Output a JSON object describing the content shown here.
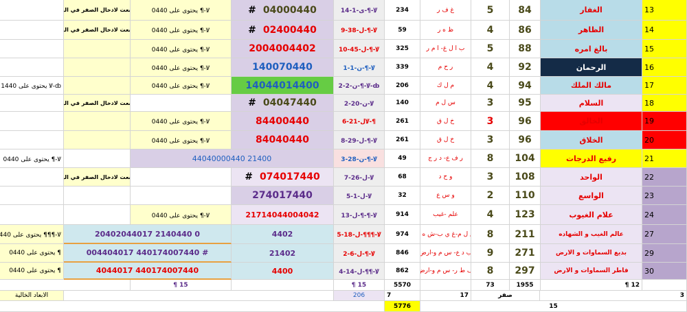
{
  "rows": [
    {
      "num": "13",
      "name": "الغفار",
      "c1": "84",
      "c2": "5",
      "letters": "غ ف ر",
      "c4": "234",
      "code": "ى-1-14-¶-Ꝟ",
      "big": "04000440",
      "hash": "#",
      "contains": "يحتوى على 0440 ¶-Ꝟ",
      "note": "وضعت لادخال الصفر في اليسار#"
    },
    {
      "num": "14",
      "name": "الظاهر",
      "c1": "86",
      "c2": "4",
      "letters": "ظ ه ر",
      "c4": "59",
      "code": "ل-38-9-¶-Ꝟ",
      "big": "02400440",
      "hash": "#",
      "contains": "يحتوى على 0440 ¶-Ꝟ",
      "note": "وضعت لادخال الصفر في اليسار#"
    },
    {
      "num": "15",
      "name": "بالغ امره",
      "c1": "88",
      "c2": "5",
      "letters": "ب ا ل غ- ا م ر",
      "c4": "325",
      "code": "ل-45-10-¶-Ꝟ",
      "big": "2004004402",
      "contains": "يحتوى على 0440 ¶-Ꝟ"
    },
    {
      "num": "16",
      "name": "الرحمان",
      "c1": "92",
      "c2": "4",
      "letters": "ر ح م",
      "c4": "339",
      "code": "ن-1-1-¶-Ꝟ",
      "big": "140070440",
      "contains": "يحتوى على 0440 ¶-Ꝟ"
    },
    {
      "num": "17",
      "name": "مالك الملك",
      "c1": "94",
      "c2": "4",
      "letters": "م ل ك",
      "c4": "206",
      "code": "ن-2-2-¶-Ꝟ-ȸ",
      "big": "14044014400",
      "contains": "يحتوى على 0440 ¶-Ꝟ",
      "extra": "يحتوى على 1440 Ꝟ-ȸ"
    },
    {
      "num": "18",
      "name": "السلام",
      "c1": "95",
      "c2": "3",
      "letters": "س ل م",
      "c4": "140",
      "code": "ن-20-2-Ꝟ",
      "big": "04047440",
      "hash": "#",
      "note": "وضعت لادخال الصفر في اليسار#"
    },
    {
      "num": "19",
      "name": "الخالق",
      "c1": "96",
      "c2": "3",
      "letters": "خ ل ق",
      "c4": "261",
      "code": "ل-21-6Ꝟ-¶",
      "big": "84400440",
      "contains": "يحتوى على 0440 ¶-Ꝟ"
    },
    {
      "num": "20",
      "name": "الخلاق",
      "c1": "96",
      "c2": "3",
      "letters": "خ ل ق",
      "c4": "261",
      "code": "ل-29-8-¶-Ꝟ",
      "big": "84040440",
      "contains": "يحتوى على 0440 ¶-Ꝟ"
    },
    {
      "num": "21",
      "name": "رفيع الدرجات",
      "c1": "104",
      "c2": "8",
      "letters": "ر ف ع- د ر ج",
      "c4": "49",
      "code": "ن-28-3-¶-Ꝟ",
      "big": "44040000440 21400",
      "contains": "يحتوى على 0440 ¶-Ꝟ"
    },
    {
      "num": "22",
      "name": "الواحد",
      "c1": "108",
      "c2": "3",
      "letters": "و ح د",
      "c4": "68",
      "code": "ل-26-7-Ꝟ",
      "big": "074017440",
      "hash": "#",
      "note": "وضعت لادخال الصفر في اليسار#"
    },
    {
      "num": "23",
      "name": "الواسع",
      "c1": "110",
      "c2": "2",
      "letters": "و س ع",
      "c4": "32",
      "code": "ل-1-5-Ꝟ",
      "big": "274017440"
    },
    {
      "num": "24",
      "name": "علام الغيوب",
      "c1": "123",
      "c2": "4",
      "letters": "علم -غيب",
      "c4": "914",
      "code": "ل-13-¶-¶-Ꝟ",
      "big": "21714044004042",
      "contains": "يحتوى على 0440 ¶-Ꝟ"
    },
    {
      "num": "27",
      "name": "عالم الغيب و الشهاده",
      "c1": "211",
      "c2": "8",
      "letters": "ع ل م-غ ي ب-ش ه د",
      "c4": "974",
      "code": "ل-18-5-¶¶¶-Ꝟ",
      "big": "20402044017 2140440 0",
      "big2": "4402",
      "contains": "يحتوى على 0440 ¶¶¶-Ꝟ"
    },
    {
      "num": "29",
      "name": "بديع السماوات و الارض",
      "c1": "271",
      "c2": "9",
      "letters": "ب د ع- س م و-ارض",
      "c4": "846",
      "code": "ل-6-2-¶-Ꝟ",
      "big": "004404017 440174007440 #",
      "big2": "21402",
      "contains": "يحتوى على 0440 ¶"
    },
    {
      "num": "30",
      "name": "فاطر السماوات و الارض",
      "c1": "297",
      "c2": "8",
      "letters": "ف ط ر- س م و-ارض",
      "c4": "862",
      "code": "ل-14-4-¶¶-Ꝟ",
      "big": "4044017 440174007440",
      "big2": "4400",
      "contains": "يحتوى على 0440 ¶"
    }
  ],
  "totals": {
    "a": "¶ 15",
    "b": "¶ 15",
    "c": "5570",
    "d": "73",
    "e": "1955",
    "f": "¶ 12",
    "g": "3"
  },
  "footer": {
    "label": "الابعاد الخالية",
    "v1": "206",
    "v2": "7",
    "v3": "17",
    "v4": "صفر",
    "v5": "15",
    "v6": "5776"
  }
}
